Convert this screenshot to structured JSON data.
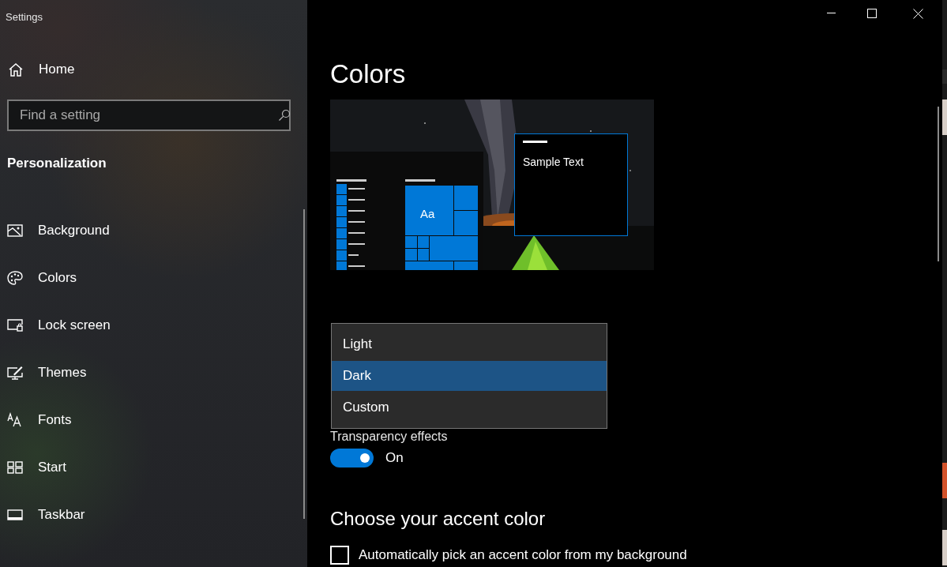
{
  "window": {
    "title": "Settings"
  },
  "sidebar": {
    "home": "Home",
    "search": {
      "placeholder": "Find a setting"
    },
    "section": "Personalization",
    "items": [
      {
        "label": "Background"
      },
      {
        "label": "Colors"
      },
      {
        "label": "Lock screen"
      },
      {
        "label": "Themes"
      },
      {
        "label": "Fonts"
      },
      {
        "label": "Start"
      },
      {
        "label": "Taskbar"
      }
    ]
  },
  "main": {
    "title": "Colors",
    "preview": {
      "tile_label": "Aa",
      "window_text": "Sample Text"
    },
    "mode_dropdown": {
      "options": [
        {
          "label": "Light",
          "selected": false
        },
        {
          "label": "Dark",
          "selected": true
        },
        {
          "label": "Custom",
          "selected": false
        }
      ]
    },
    "transparency": {
      "label": "Transparency effects",
      "on": true,
      "state_text": "On"
    },
    "accent": {
      "heading": "Choose your accent color",
      "auto_pick": {
        "label": "Automatically pick an accent color from my background",
        "checked": false
      }
    }
  }
}
